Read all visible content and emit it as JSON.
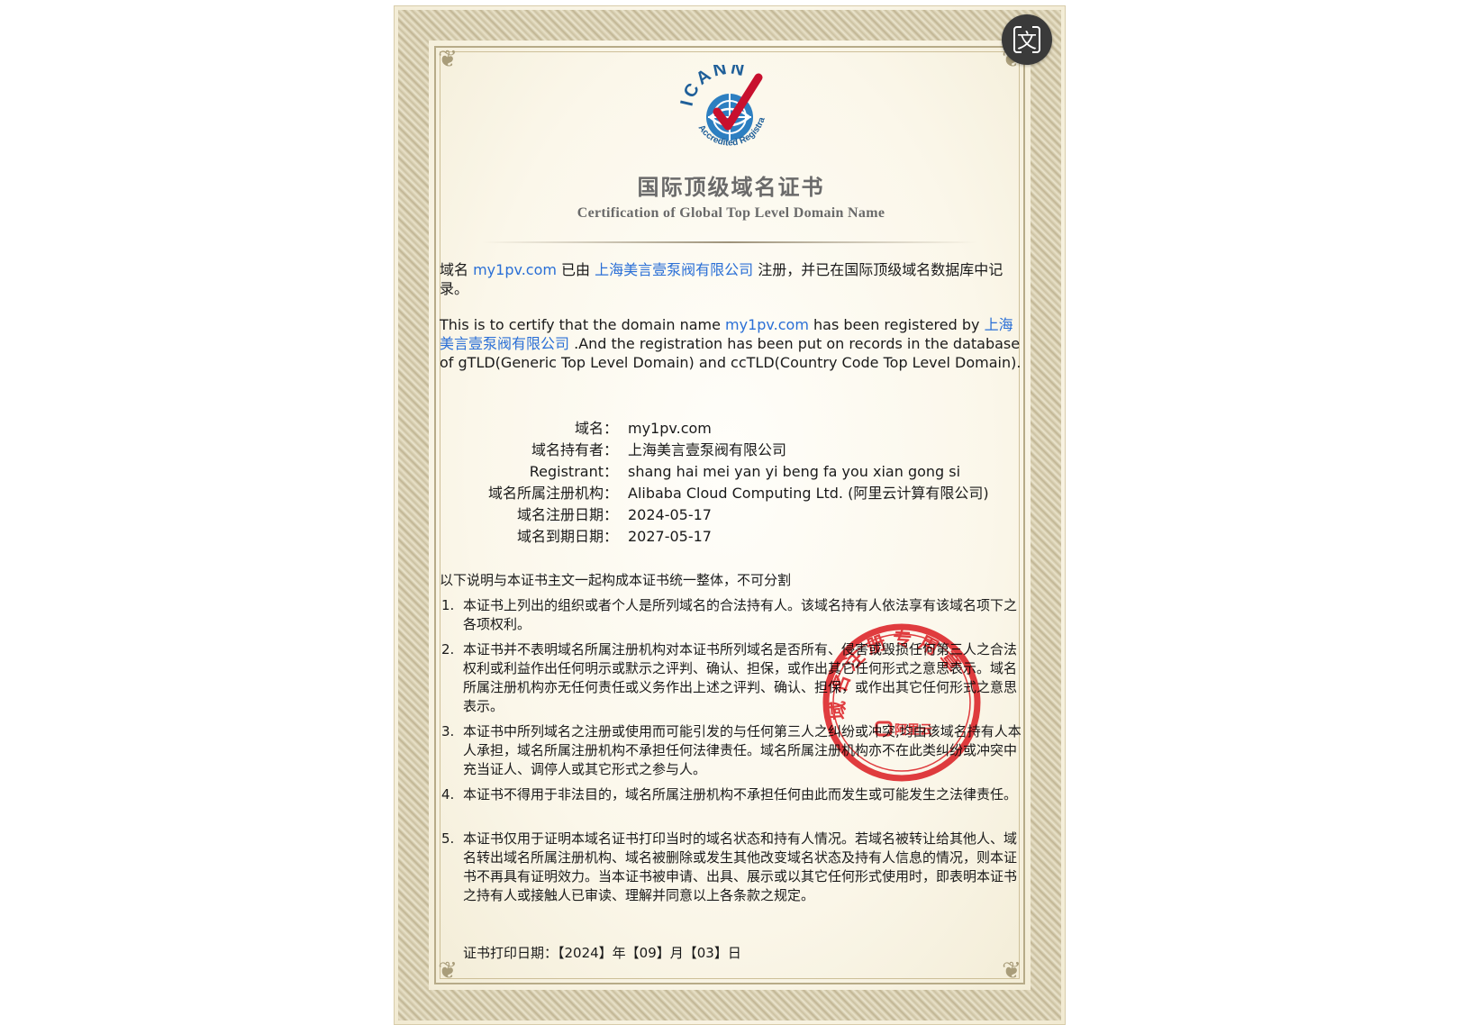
{
  "toolbar": {
    "translate_icon": "translate-icon",
    "translate_glyph": "文"
  },
  "logo": {
    "text_main": "ICANN",
    "text_ring": "Accredited Registrar"
  },
  "title": {
    "cn": "国际顶级域名证书",
    "en": "Certification of Global Top Level Domain Name"
  },
  "intro_cn": {
    "p1": "域名 ",
    "domain": "my1pv.com",
    "p2": " 已由 ",
    "holder": "上海美言壹泵阀有限公司",
    "p3": " 注册，并已在国际顶级域名数据库中记录。"
  },
  "intro_en": {
    "p1": "This is to certify that the domain name ",
    "domain": "my1pv.com",
    "p2": " has been registered by ",
    "holder": "上海美言壹泵阀有限公司",
    "p3": " .And the registration has been put on records in the database of gTLD(Generic Top Level Domain) and ccTLD(Country Code Top Level Domain)."
  },
  "details": [
    {
      "label": "域名：",
      "value": "my1pv.com"
    },
    {
      "label": "域名持有者：",
      "value": "上海美言壹泵阀有限公司"
    },
    {
      "label": "Registrant：",
      "value": "shang hai mei yan yi beng fa you xian gong si"
    },
    {
      "label": "域名所属注册机构：",
      "value": "Alibaba Cloud Computing Ltd. (阿里云计算有限公司)"
    },
    {
      "label": "域名注册日期：",
      "value": "2024-05-17"
    },
    {
      "label": "域名到期日期：",
      "value": "2027-05-17"
    }
  ],
  "notes_heading": "以下说明与本证书主文一起构成本证书统一整体，不可分割",
  "notes": [
    {
      "num": "1.",
      "text": "本证书上列出的组织或者个人是所列域名的合法持有人。该域名持有人依法享有该域名项下之各项权利。"
    },
    {
      "num": "2.",
      "text": "本证书并不表明域名所属注册机构对本证书所列域名是否所有、侵害或毁损任何第三人之合法权利或利益作出任何明示或默示之评判、确认、担保，或作出其它任何形式之意思表示。域名所属注册机构亦无任何责任或义务作出上述之评判、确认、担保，或作出其它任何形式之意思表示。"
    },
    {
      "num": "3.",
      "text": "本证书中所列域名之注册或使用而可能引发的与任何第三人之纠纷或冲突,均由该域名持有人本人承担，域名所属注册机构不承担任何法律责任。域名所属注册机构亦不在此类纠纷或冲突中充当证人、调停人或其它形式之参与人。"
    },
    {
      "num": "4.",
      "text": "本证书不得用于非法目的，域名所属注册机构不承担任何由此而发生或可能发生之法律责任。"
    },
    {
      "num": "5.",
      "text": "本证书仅用于证明本域名证书打印当时的域名状态和持有人情况。若域名被转让给其他人、域名转出域名所属注册机构、域名被删除或发生其他改变域名状态及持有人信息的情况，则本证书不再具有证明效力。当本证书被申请、出具、展示或以其它任何形式使用时，即表明本证书之持有人或接触人已审读、理解并同意以上各条款之规定。"
    }
  ],
  "print_date": "证书打印日期：【2024】年【09】月【03】日",
  "stamp": {
    "ring_text": "域名注册专用章",
    "center_text": "阿里云",
    "color": "#e0282e"
  },
  "colors": {
    "link": "#2a6fd6",
    "title": "#6a6a6a",
    "paper": "#fbf7ea"
  }
}
